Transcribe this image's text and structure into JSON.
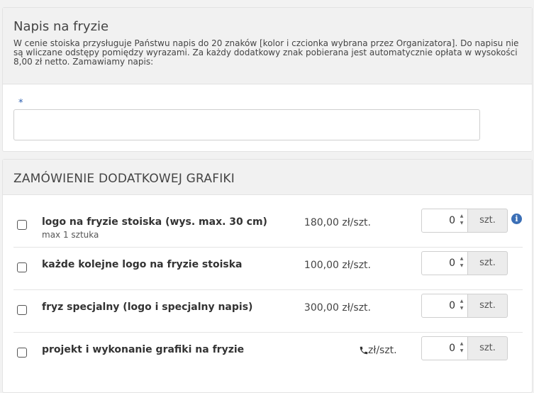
{
  "fryz_text": {
    "title": "Napis na fryzie",
    "description": "W cenie stoiska przysługuje Państwu napis do 20 znaków [kolor i czcionka wybrana przez Organizatora]. Do napisu nie są wliczane odstępy pomiędzy wyrazami. Za każdy dodatkowy znak pobierana jest automatycznie opłata w wysokości 8,00 zł netto. Zamawiamy napis:",
    "required_mark": "*",
    "input_value": ""
  },
  "graphics": {
    "title": "ZAMÓWIENIE DODATKOWEJ GRAFIKI",
    "unit_label": "zł/szt.",
    "addon_label": "szt.",
    "items": [
      {
        "label": "logo na fryzie stoiska (wys. max. 30 cm)",
        "sublabel": "max 1 sztuka",
        "price": "180,00",
        "quantity": "0",
        "has_info": true
      },
      {
        "label": "każde kolejne logo na fryzie stoiska",
        "price": "100,00",
        "quantity": "0"
      },
      {
        "label": "fryz specjalny (logo i specjalny napis)",
        "price": "300,00",
        "quantity": "0"
      },
      {
        "label": "projekt i wykonanie grafiki na fryzie",
        "price_icon": "phone-icon",
        "quantity": "0"
      }
    ]
  },
  "colors": {
    "accent": "#3b6fb6",
    "header_bg": "#f1f1f1",
    "border": "#e3e3e3"
  }
}
